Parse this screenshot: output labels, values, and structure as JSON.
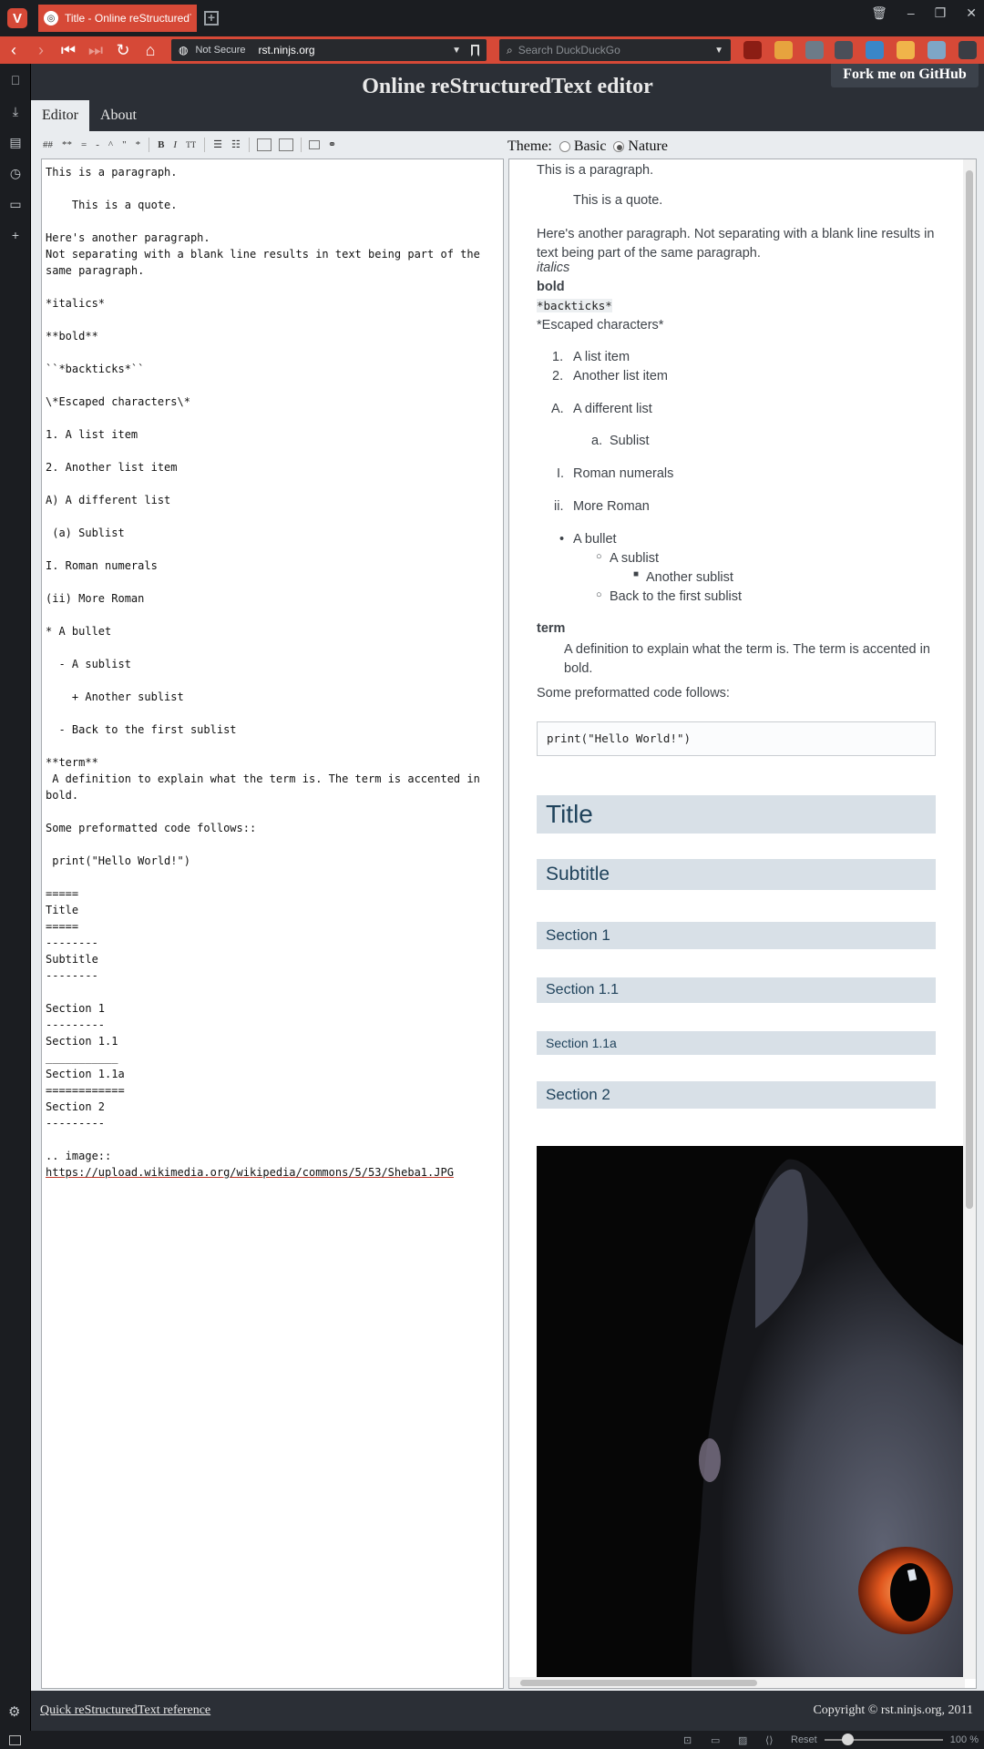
{
  "browser": {
    "tab_title": "Title - Online reStructuredT",
    "url_security": "Not Secure",
    "url_domain": "rst.ninjs.org",
    "search_placeholder": "Search DuckDuckGo",
    "zoom_reset": "Reset",
    "zoom_level": "100 %",
    "accent": "#d64937"
  },
  "page": {
    "title": "Online reStructuredText editor",
    "fork_label": "Fork me on GitHub",
    "tabs": [
      {
        "label": "Editor",
        "active": true
      },
      {
        "label": "About",
        "active": false
      }
    ],
    "theme_label": "Theme:",
    "theme_options": [
      {
        "label": "Basic",
        "selected": false
      },
      {
        "label": "Nature",
        "selected": true
      }
    ],
    "toolbar": [
      "##",
      "**",
      "=",
      "-",
      "^",
      "\"",
      "*",
      "B",
      "I",
      "TT"
    ],
    "footer_link": "Quick reStructuredText reference",
    "footer_copyright": "Copyright © rst.ninjs.org, 2011"
  },
  "editor": {
    "lines": [
      "This is a paragraph.",
      "",
      "    This is a quote.",
      "",
      "Here's another paragraph.",
      "Not separating with a blank line results in text being part of the",
      "same paragraph.",
      "",
      "*italics*",
      "",
      "**bold**",
      "",
      "``*backticks*``",
      "",
      "\\*Escaped characters\\*",
      "",
      "1. A list item",
      "",
      "2. Another list item",
      "",
      "A) A different list",
      "",
      " (a) Sublist",
      "",
      "I. Roman numerals",
      "",
      "(ii) More Roman",
      "",
      "* A bullet",
      "",
      "  - A sublist",
      "",
      "    + Another sublist",
      "",
      "  - Back to the first sublist",
      "",
      "**term**",
      " A definition to explain what the term is. The term is accented in",
      "bold.",
      "",
      "Some preformatted code follows::",
      "",
      " print(\"Hello World!\")",
      "",
      "=====",
      "Title",
      "=====",
      "--------",
      "Subtitle",
      "--------",
      "",
      "Section 1",
      "---------",
      "Section 1.1",
      "___________",
      "Section 1.1a",
      "============",
      "Section 2",
      "---------",
      "",
      ".. image::"
    ],
    "image_url": "https://upload.wikimedia.org/wikipedia/commons/5/53/Sheba1.JPG"
  },
  "preview": {
    "p1": "This is a paragraph.",
    "quote": "This is a quote.",
    "p2": "Here's another paragraph. Not separating with a blank line results in text being part of the same paragraph.",
    "italics": "italics",
    "bold": "bold",
    "backticks": "*backticks*",
    "escaped": "*Escaped characters*",
    "ol1": [
      "A list item",
      "Another list item"
    ],
    "ol_alpha": "A different list",
    "sublist": "Sublist",
    "roman1": "Roman numerals",
    "roman2": "More Roman",
    "bullet": "A bullet",
    "bsub1": "A sublist",
    "bsub2": "Another sublist",
    "bsub3": "Back to the first sublist",
    "term": "term",
    "definition": "A definition to explain what the term is. The term is accented in bold.",
    "code_intro": "Some preformatted code follows:",
    "code": "print(\"Hello World!\")",
    "headings": {
      "title": "Title",
      "subtitle": "Subtitle",
      "section1": "Section 1",
      "section11": "Section 1.1",
      "section11a": "Section 1.1a",
      "section2": "Section 2"
    },
    "marker_1": "1.",
    "marker_2": "2.",
    "marker_A": "A.",
    "marker_a": "a.",
    "marker_I": "I.",
    "marker_ii": "ii."
  }
}
